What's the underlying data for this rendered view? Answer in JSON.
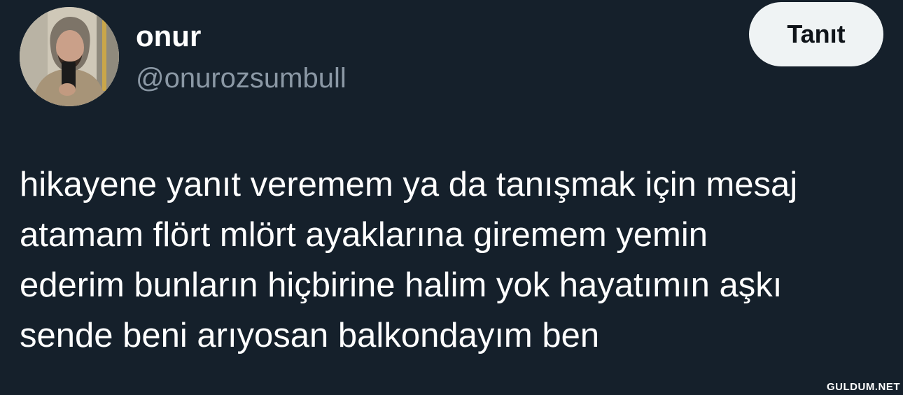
{
  "tweet": {
    "author": {
      "display_name": "onur",
      "handle": "@onurozsumbull",
      "avatar_icon": "profile-photo"
    },
    "follow_button_label": "Tanıt",
    "text": "hikayene yanıt veremem ya da tanışmak için mesaj\natamam flört mlört ayaklarına giremem yemin\nederim bunların hiçbirine halim yok hayatımın aşkı\nsende beni arıyosan balkondayım ben"
  },
  "watermark": "GULDUM.NET",
  "colors": {
    "background": "#15202b",
    "text": "#ffffff",
    "handle": "#8b98a5",
    "button_bg": "#eff3f4",
    "button_text": "#0f1419"
  }
}
